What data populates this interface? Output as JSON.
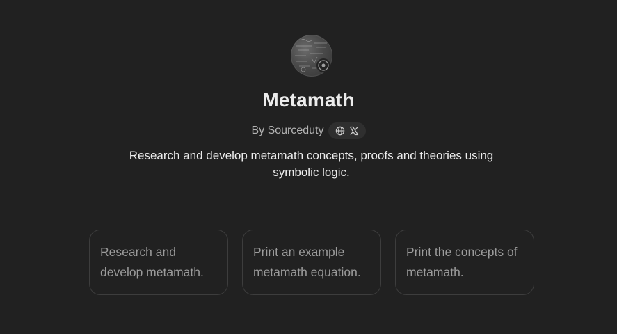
{
  "gpt": {
    "avatar_icon": "math-chalkboard-avatar",
    "name": "Metamath",
    "byline": "By Sourceduty",
    "social_icons": [
      "globe-icon",
      "x-logo-icon"
    ],
    "description": "Research and develop metamath concepts, proofs and theories using symbolic logic."
  },
  "starters": [
    {
      "label": "Research and develop metamath."
    },
    {
      "label": "Print an example metamath equation."
    },
    {
      "label": "Print the concepts of metamath."
    }
  ],
  "colors": {
    "background": "#212121",
    "card_border": "#3d3d3d",
    "pill_background": "#2f2f2f",
    "primary_text": "#ececec",
    "secondary_text": "#b4b4b4",
    "card_text": "#9b9b9b"
  }
}
